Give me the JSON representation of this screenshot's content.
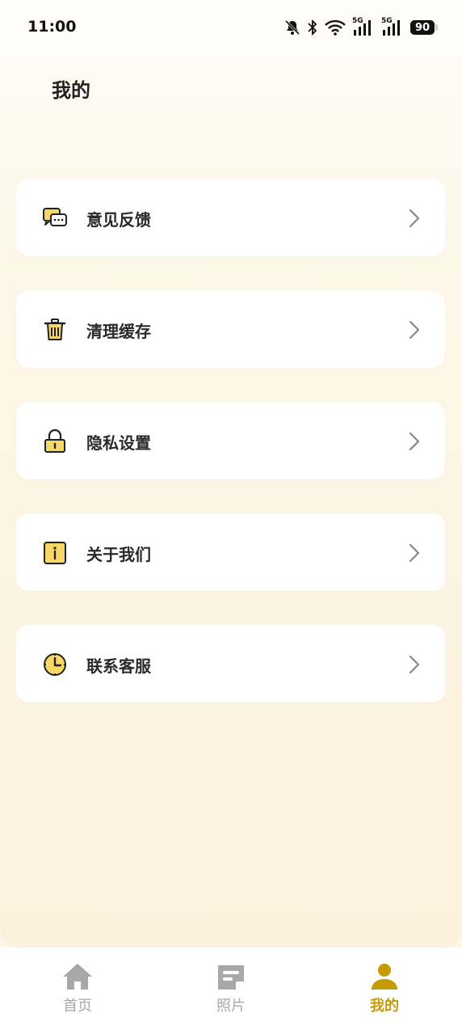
{
  "status_bar": {
    "time": "11:00",
    "battery": "90",
    "signal_label_1": "5G",
    "signal_label_2": "5G"
  },
  "page_title": "我的",
  "menu": [
    {
      "label": "意见反馈",
      "icon": "feedback-chat-icon"
    },
    {
      "label": "清理缓存",
      "icon": "trash-icon"
    },
    {
      "label": "隐私设置",
      "icon": "lock-icon"
    },
    {
      "label": "关于我们",
      "icon": "info-icon"
    },
    {
      "label": "联系客服",
      "icon": "clock-icon"
    }
  ],
  "tabbar": {
    "tabs": [
      {
        "label": "首页",
        "icon": "home-icon",
        "active": false
      },
      {
        "label": "照片",
        "icon": "photo-note-icon",
        "active": false
      },
      {
        "label": "我的",
        "icon": "user-icon",
        "active": true
      }
    ]
  },
  "colors": {
    "accent": "#c69b05",
    "icon_fill": "#f7d766",
    "tab_inactive": "#a8a8a8"
  }
}
